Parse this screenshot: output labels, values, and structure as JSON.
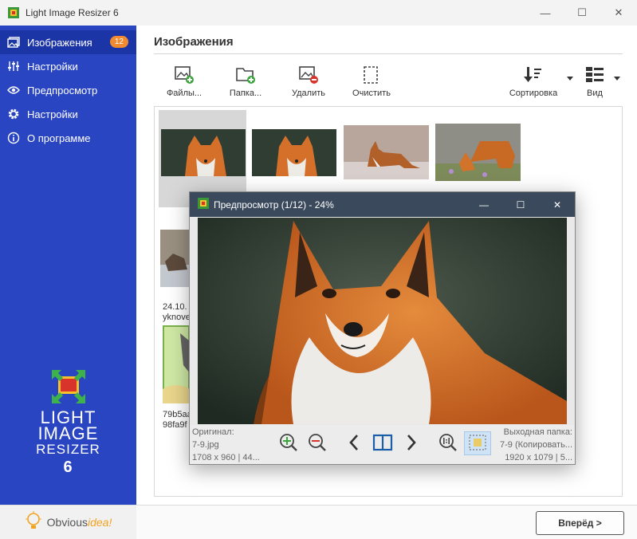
{
  "window": {
    "title": "Light Image Resizer 6",
    "minimize_glyph": "—",
    "maximize_glyph": "☐",
    "close_glyph": "✕"
  },
  "sidebar": {
    "items": [
      {
        "label": "Изображения",
        "icon": "images-icon",
        "badge": "12",
        "active": true
      },
      {
        "label": "Настройки",
        "icon": "sliders-icon"
      },
      {
        "label": "Предпросмотр",
        "icon": "eye-icon"
      },
      {
        "label": "Настройки",
        "icon": "gear-icon"
      },
      {
        "label": "О программе",
        "icon": "info-icon"
      }
    ],
    "logo": {
      "line1": "LIGHT",
      "line2": "IMAGE",
      "line3": "RESIZER",
      "line4": "6"
    },
    "brand": {
      "part1": "Obvious",
      "part2": "idea!"
    }
  },
  "main": {
    "title": "Изображения",
    "toolbar": {
      "files": "Файлы...",
      "folder": "Папка...",
      "remove": "Удалить",
      "clear": "Очистить",
      "sort": "Сортировка",
      "view": "Вид"
    },
    "thumbs_text": {
      "date_partial": "24.10.",
      "name_partial": "yknove",
      "hash_partial1": "79b5aa",
      "hash_partial2": "98fa9f"
    },
    "next_button": "Вперёд >"
  },
  "preview": {
    "title": "Предпросмотр (1/12) - 24%",
    "original_label": "Оригинал:",
    "original_file": "7-9.jpg",
    "original_meta": "1708 x 960  |  44...",
    "output_label": "Выходная папка:",
    "output_file": "7-9 (Копировать...",
    "output_meta": "1920 x 1079  |  5..."
  },
  "colors": {
    "sidebar": "#2a45c2",
    "sidebar_active": "#1c35a6",
    "badge": "#f28b30",
    "preview_titlebar": "#3a4a5c"
  }
}
